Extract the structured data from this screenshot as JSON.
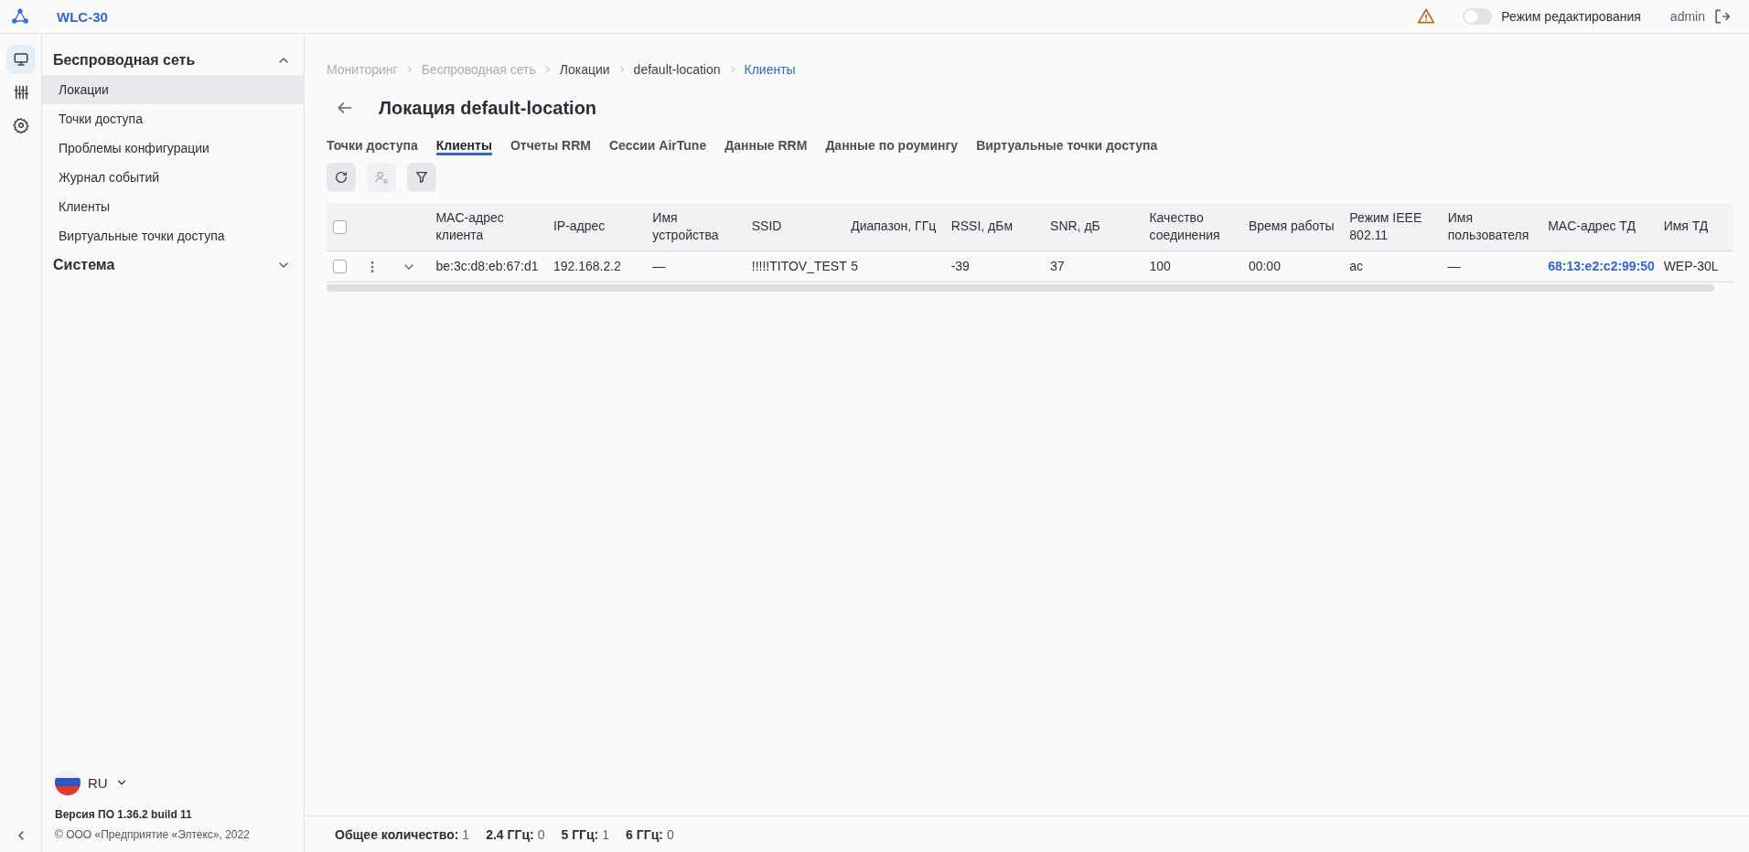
{
  "app": {
    "title": "WLC-30"
  },
  "topbar": {
    "edit_mode": {
      "label": "Режим редактирования",
      "on": false
    },
    "user": "admin"
  },
  "rail": [
    {
      "kind": "monitor",
      "selected": true
    },
    {
      "kind": "sliders",
      "selected": false
    },
    {
      "kind": "gear",
      "selected": false
    }
  ],
  "sidebar": {
    "sections": [
      {
        "title": "Беспроводная сеть",
        "expanded": true,
        "items": [
          {
            "label": "Локации",
            "selected": true
          },
          {
            "label": "Точки доступа",
            "selected": false
          },
          {
            "label": "Проблемы конфигурации",
            "selected": false
          },
          {
            "label": "Журнал событий",
            "selected": false
          },
          {
            "label": "Клиенты",
            "selected": false
          },
          {
            "label": "Виртуальные точки доступа",
            "selected": false
          }
        ]
      },
      {
        "title": "Система",
        "expanded": false
      }
    ],
    "language": "RU",
    "version": "Версия ПО 1.36.2 build 11",
    "copyright": "© ООО «Предприятие «Элтекс», 2022"
  },
  "breadcrumb": [
    {
      "label": "Мониторинг",
      "kind": "muted"
    },
    {
      "label": "Беспроводная сеть",
      "kind": "muted"
    },
    {
      "label": "Локации",
      "kind": "link"
    },
    {
      "label": "default-location",
      "kind": "link"
    },
    {
      "label": "Клиенты",
      "kind": "current"
    }
  ],
  "page": {
    "title": "Локация default-location"
  },
  "tabs": [
    {
      "label": "Точки доступа",
      "selected": false
    },
    {
      "label": "Клиенты",
      "selected": true
    },
    {
      "label": "Отчеты RRM",
      "selected": false
    },
    {
      "label": "Сессии AirTune",
      "selected": false
    },
    {
      "label": "Данные RRM",
      "selected": false
    },
    {
      "label": "Данные по роумингу",
      "selected": false
    },
    {
      "label": "Виртуальные точки доступа",
      "selected": false
    }
  ],
  "toolbar": [
    {
      "kind": "refresh",
      "disabled": false
    },
    {
      "kind": "deauth",
      "disabled": true
    },
    {
      "kind": "filter",
      "disabled": false
    }
  ],
  "table": {
    "all_checked": false,
    "columns": [
      {
        "label": "MAC-адрес клиента",
        "kind": "text"
      },
      {
        "label": "IP-адрес",
        "kind": "text"
      },
      {
        "label": "Имя устройства",
        "kind": "text"
      },
      {
        "label": "SSID",
        "kind": "text"
      },
      {
        "label": "Диапазон, ГГц",
        "kind": "text"
      },
      {
        "label": "RSSI, дБм",
        "kind": "text"
      },
      {
        "label": "SNR, дБ",
        "kind": "text"
      },
      {
        "label": "Качество соединения",
        "kind": "text"
      },
      {
        "label": "Время работы",
        "kind": "text"
      },
      {
        "label": "Режим IEEE 802.11",
        "kind": "text"
      },
      {
        "label": "Имя пользователя",
        "kind": "text"
      },
      {
        "label": "MAC-адрес ТД",
        "kind": "link"
      },
      {
        "label": "Имя ТД",
        "kind": "text"
      }
    ],
    "rows": [
      {
        "checked": false,
        "expanded": false,
        "cells": [
          "be:3c:d8:eb:67:d1",
          "192.168.2.2",
          "—",
          "!!!!!TITOV_TEST",
          "5",
          "-39",
          "37",
          "100",
          "00:00",
          "ac",
          "—",
          "68:13:e2:c2:99:50",
          "WEP-30L"
        ]
      }
    ]
  },
  "footer": [
    {
      "label": "Общее количество:",
      "value": "1"
    },
    {
      "label": "2.4 ГГц:",
      "value": "0"
    },
    {
      "label": "5 ГГц:",
      "value": "1"
    },
    {
      "label": "6 ГГц:",
      "value": "0"
    }
  ]
}
